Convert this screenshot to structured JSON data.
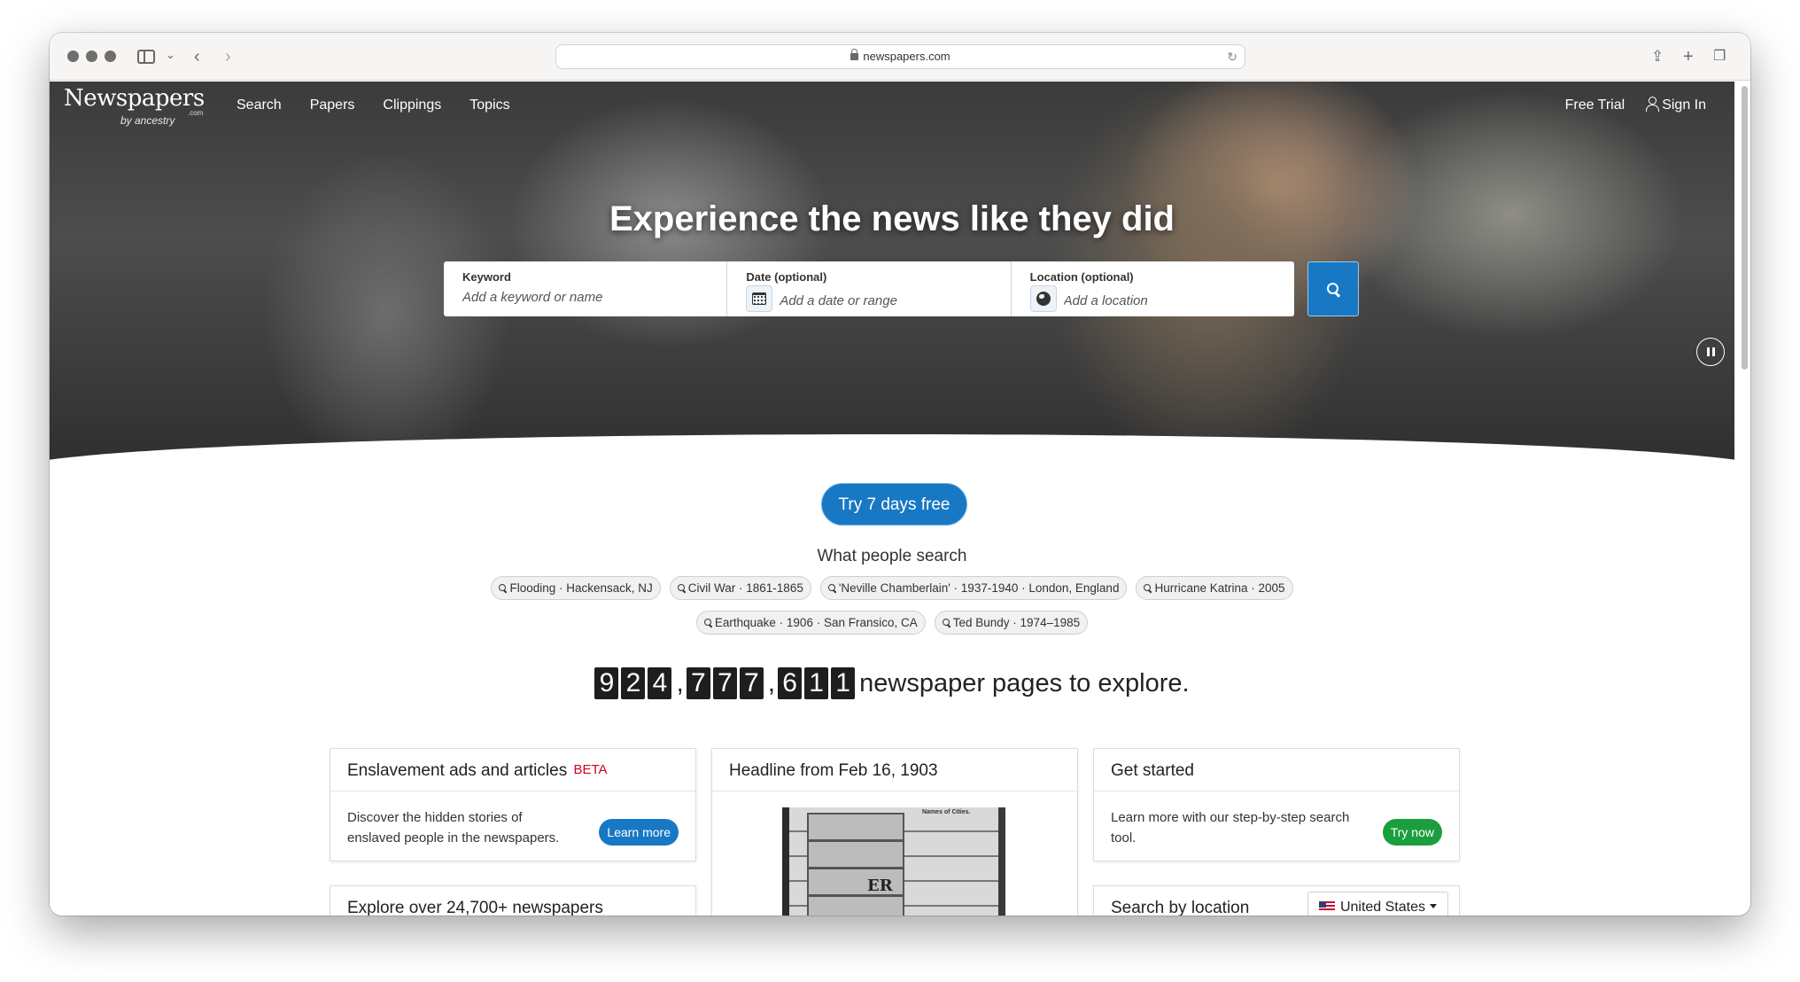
{
  "browser": {
    "url": "newspapers.com"
  },
  "nav": {
    "logo_main": "Newspapers",
    "logo_com": ".com",
    "logo_by": "by ancestry",
    "links": [
      "Search",
      "Papers",
      "Clippings",
      "Topics"
    ],
    "free_trial": "Free Trial",
    "sign_in": "Sign In"
  },
  "hero": {
    "title": "Experience the news like they did",
    "keyword_label": "Keyword",
    "keyword_placeholder": "Add a keyword or name",
    "date_label": "Date (optional)",
    "date_placeholder": "Add a date or range",
    "location_label": "Location (optional)",
    "location_placeholder": "Add a location"
  },
  "trial_button": "Try 7 days free",
  "what_people_search": {
    "title": "What people search",
    "row1": [
      "Flooding · Hackensack, NJ",
      "Civil War · 1861-1865",
      "'Neville Chamberlain' · 1937-1940 · London, England",
      "Hurricane Katrina · 2005"
    ],
    "row2": [
      "Earthquake · 1906 · San Fransico, CA",
      "Ted Bundy · 1974–1985"
    ]
  },
  "counter": {
    "digits": [
      "9",
      "2",
      "4",
      ",",
      "7",
      "7",
      "7",
      ",",
      "6",
      "1",
      "1"
    ],
    "text": "newspaper pages to explore."
  },
  "cards": {
    "enslavement": {
      "title": "Enslavement ads and articles",
      "badge": "BETA",
      "body": "Discover the hidden stories of enslaved people in the newspapers.",
      "button": "Learn more"
    },
    "explore": {
      "title": "Explore over 24,700+ newspapers"
    },
    "headline": {
      "title": "Headline from Feb 16, 1903",
      "image_text": "ER",
      "image_heading": "Names of Cities."
    },
    "get_started": {
      "title": "Get started",
      "body": "Learn more with our step-by-step search tool.",
      "button": "Try now"
    },
    "location": {
      "title": "Search by location",
      "selected": "United States"
    }
  }
}
